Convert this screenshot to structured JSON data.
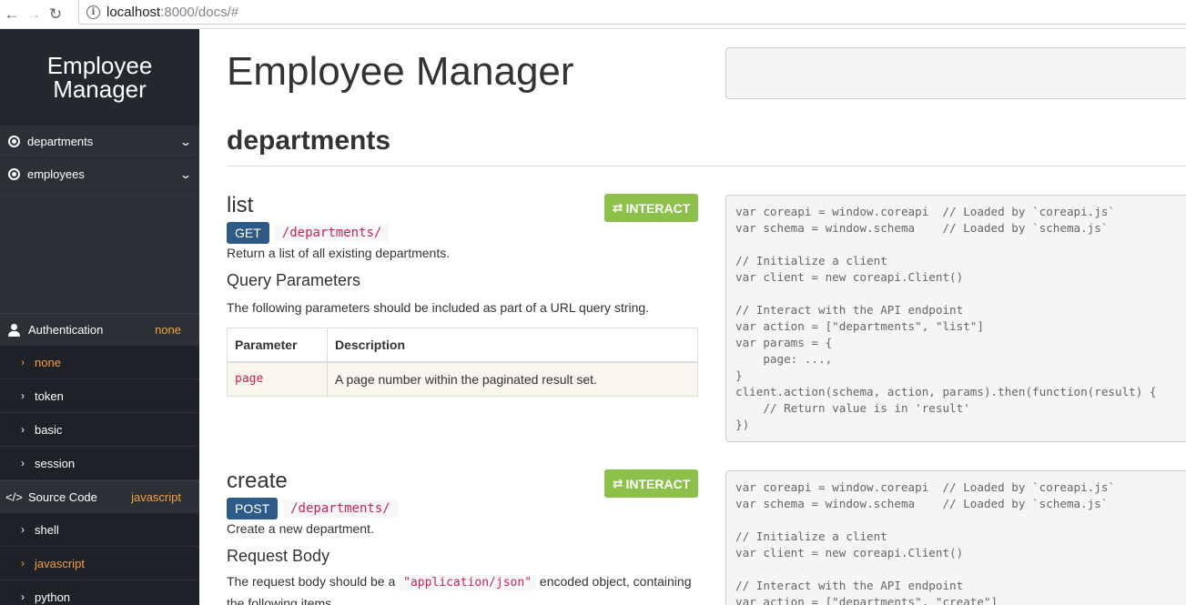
{
  "browser": {
    "url_host": "localhost",
    "url_path": ":8000/docs/#",
    "back_glyph": "←",
    "forward_glyph": "→",
    "reload_glyph": "↻"
  },
  "sidebar": {
    "brand_line1": "Employee",
    "brand_line2": "Manager",
    "groups": [
      {
        "label": "departments",
        "icon": "target-icon"
      },
      {
        "label": "employees",
        "icon": "target-icon"
      }
    ],
    "authentication": {
      "label": "Authentication",
      "value": "none",
      "options": [
        "none",
        "token",
        "basic",
        "session"
      ],
      "active": "none"
    },
    "source_code": {
      "label": "Source Code",
      "icon_text": "</>",
      "value": "javascript",
      "options": [
        "shell",
        "javascript",
        "python"
      ],
      "active": "javascript"
    },
    "arrow": "›",
    "chevron": "⌄"
  },
  "main": {
    "title": "Employee Manager",
    "section_title": "departments",
    "interact_label": "INTERACT",
    "interact_icon": "⇄",
    "list": {
      "name": "list",
      "method": "GET",
      "path": "/departments/",
      "description": "Return a list of all existing departments.",
      "query_heading": "Query Parameters",
      "query_text": "The following parameters should be included as part of a URL query string.",
      "table_headers": [
        "Parameter",
        "Description"
      ],
      "table_rows": [
        {
          "param": "page",
          "desc": "A page number within the paginated result set."
        }
      ],
      "code": "var coreapi = window.coreapi  // Loaded by `coreapi.js`\nvar schema = window.schema    // Loaded by `schema.js`\n\n// Initialize a client\nvar client = new coreapi.Client()\n\n// Interact with the API endpoint\nvar action = [\"departments\", \"list\"]\nvar params = {\n    page: ...,\n}\nclient.action(schema, action, params).then(function(result) {\n    // Return value is in 'result'\n})"
    },
    "create": {
      "name": "create",
      "method": "POST",
      "path": "/departments/",
      "description": "Create a new department.",
      "body_heading": "Request Body",
      "body_text_before": "The request body should be a ",
      "body_code": "\"application/json\"",
      "body_text_after": " encoded object, containing",
      "body_text_line2": "the following items.",
      "code": "var coreapi = window.coreapi  // Loaded by `coreapi.js`\nvar schema = window.schema    // Loaded by `schema.js`\n\n// Initialize a client\nvar client = new coreapi.Client()\n\n// Interact with the API endpoint\nvar action = [\"departments\", \"create\"]"
    }
  },
  "colors": {
    "sidebar_bg": "#2c3037",
    "accent_orange": "#f1a13f",
    "interact_green": "#8cc04b",
    "method_blue": "#2e5a87",
    "code_red": "#c7254e"
  }
}
